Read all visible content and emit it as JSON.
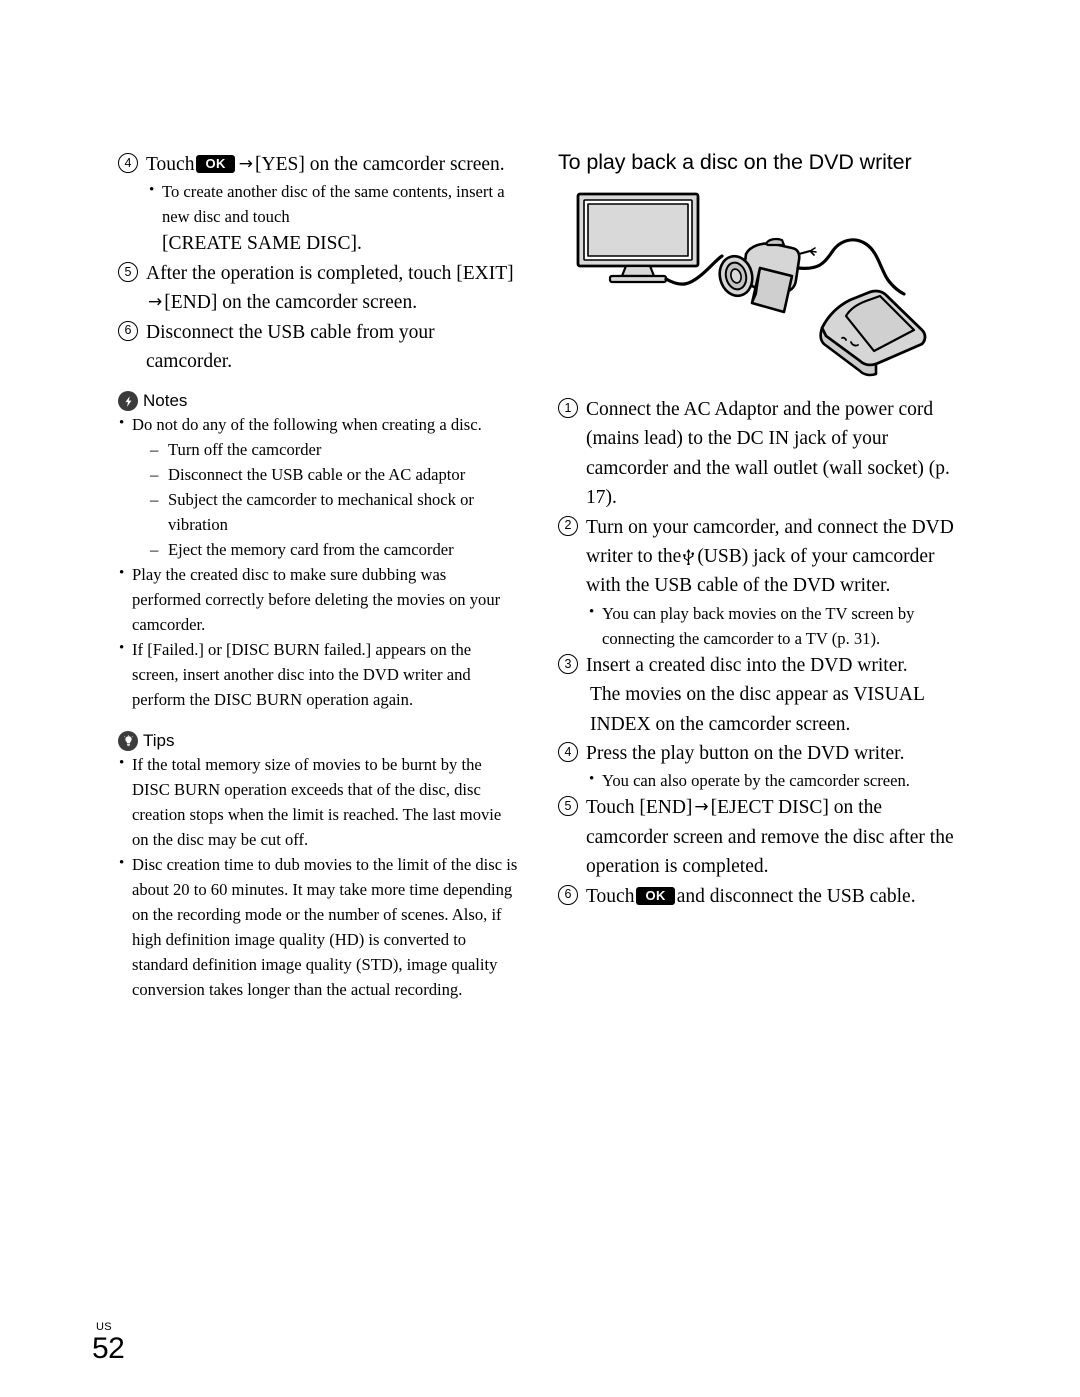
{
  "page": {
    "footer_locale": "US",
    "footer_number": "52"
  },
  "left_column": {
    "step4": {
      "number": "4",
      "text_before_button": "Touch",
      "button_label": "OK",
      "arrow": "→",
      "text_after_button": "[YES] on the camcorder screen.",
      "bullets": [
        "To create another disc of the same contents, insert a new disc and touch"
      ],
      "emphasis_line": "[CREATE SAME DISC]."
    },
    "step5": {
      "number": "5",
      "part1": "After the operation is completed, touch [EXIT]",
      "arrow": "→",
      "part2": "[END] on the camcorder screen."
    },
    "step6": {
      "number": "6",
      "text": "Disconnect the USB cable from your camcorder."
    },
    "notes": {
      "icon": "lightning-bolt-icon",
      "label": "Notes",
      "items": [
        {
          "text": "Do not do any of the following when creating a disc.",
          "subitems": [
            "Turn off the camcorder",
            "Disconnect the USB cable or the AC adaptor",
            "Subject the camcorder to mechanical shock or vibration",
            "Eject the memory card from the camcorder"
          ]
        },
        {
          "text": "Play the created disc to make sure dubbing was performed correctly before deleting the movies on your camcorder.",
          "subitems": []
        },
        {
          "text": "If [Failed.] or [DISC BURN failed.] appears on the screen, insert another disc into the DVD writer and perform the DISC BURN operation again.",
          "subitems": []
        }
      ]
    },
    "tips": {
      "icon": "lightbulb-icon",
      "label": "Tips",
      "items": [
        "If the total memory size of movies to be burnt by the DISC BURN operation exceeds that of the disc, disc creation stops when the limit is reached. The last movie on the disc may be cut off.",
        "Disc creation time to dub movies to the limit of the disc is about 20 to 60 minutes. It may take more time depending on the recording mode or the number of scenes. Also, if high definition image quality (HD) is converted to standard definition image quality (STD), image quality conversion takes longer than the actual recording."
      ]
    }
  },
  "right_column": {
    "heading": "To play back a disc on the DVD writer",
    "illustration": {
      "name": "tv-camcorder-dvd-writer-connection-diagram",
      "parts": [
        "television",
        "camcorder",
        "dvd-writer",
        "connection-cables"
      ]
    },
    "step1": {
      "number": "1",
      "text": "Connect the AC Adaptor and the power cord  (mains lead) to the DC IN jack of your camcorder and the wall outlet (wall socket) (p. 17)."
    },
    "step2": {
      "number": "2",
      "part1": "Turn on your camcorder, and connect the DVD writer to the",
      "usb_icon": "usb-icon",
      "part2": "(USB) jack of your camcorder with the USB cable of the DVD writer.",
      "bullets": [
        "You can play back movies on the TV screen by connecting the camcorder to a TV (p. 31)."
      ]
    },
    "step3": {
      "number": "3",
      "text": "Insert a created disc into the DVD writer.",
      "continuation": "The movies on the disc appear as VISUAL INDEX on the camcorder screen."
    },
    "step4": {
      "number": "4",
      "text": "Press the play button on the DVD writer.",
      "bullets": [
        "You can also operate by the camcorder screen."
      ]
    },
    "step5": {
      "number": "5",
      "part1": "Touch [END]",
      "arrow": "→",
      "part2": "[EJECT DISC] on the camcorder screen and remove the disc after the operation is completed."
    },
    "step6": {
      "number": "6",
      "text_before_button": "Touch",
      "button_label": "OK",
      "text_after_button": "and disconnect the USB cable."
    }
  }
}
